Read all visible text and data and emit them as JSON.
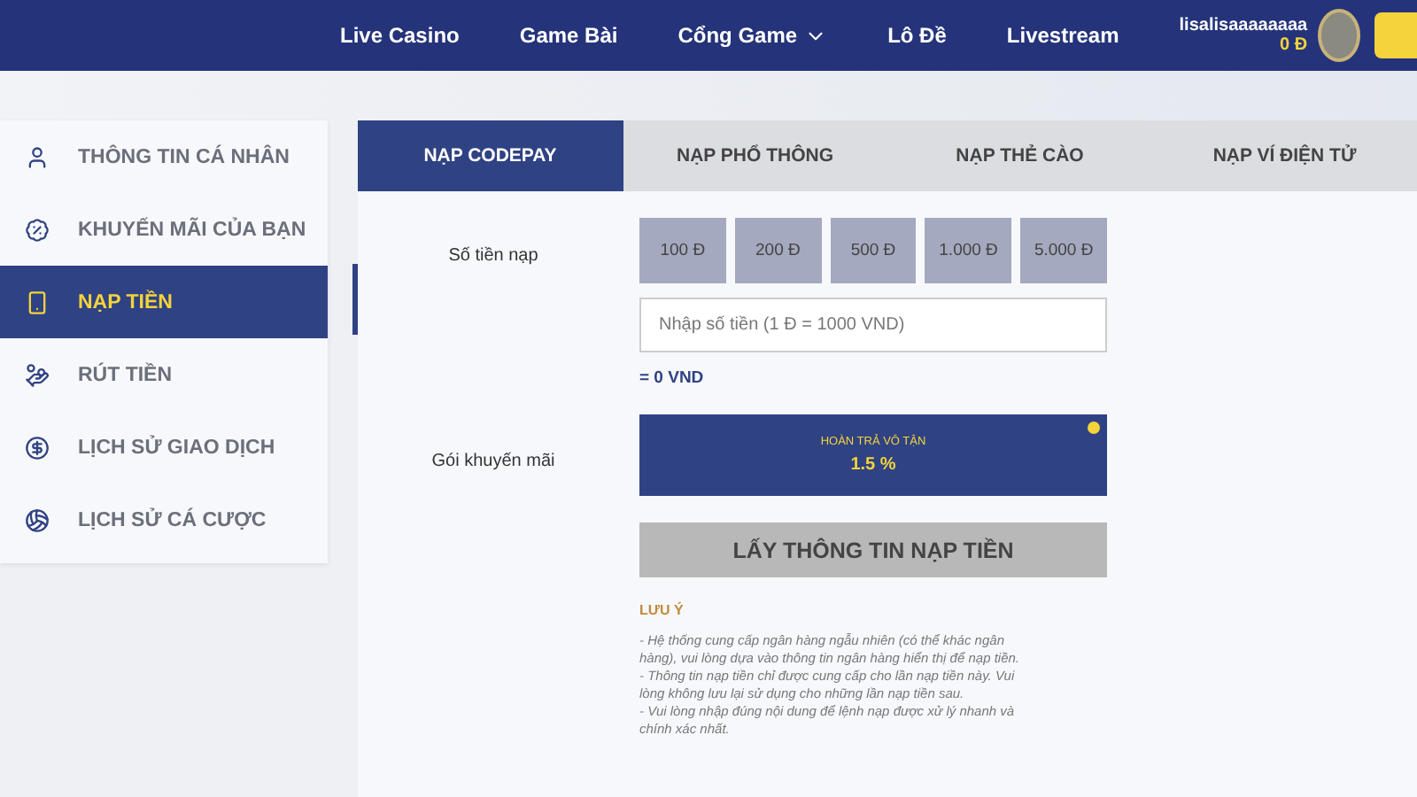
{
  "header": {
    "nav": [
      {
        "label": "Live Casino",
        "kind": "link"
      },
      {
        "label": "Game Bài",
        "kind": "link"
      },
      {
        "label": "Cổng Game",
        "kind": "dropdown"
      },
      {
        "label": "Lô Đề",
        "kind": "link"
      },
      {
        "label": "Livestream",
        "kind": "link"
      }
    ],
    "user": {
      "name": "lisalisaaaaaaaa",
      "balance": "0 Đ"
    }
  },
  "sidebar": {
    "items": [
      {
        "label": "THÔNG TIN CÁ NHÂN",
        "selected": false
      },
      {
        "label": "KHUYẾN MÃI CỦA BẠN",
        "selected": false
      },
      {
        "label": "NẠP TIỀN",
        "selected": true
      },
      {
        "label": "RÚT TIỀN",
        "selected": false
      },
      {
        "label": "LỊCH SỬ GIAO DỊCH",
        "selected": false
      },
      {
        "label": "LỊCH SỬ CÁ CƯỢC",
        "selected": false
      }
    ]
  },
  "tabs": [
    {
      "label": "NẠP CODEPAY",
      "selected": true
    },
    {
      "label": "NẠP PHỔ THÔNG",
      "selected": false
    },
    {
      "label": "NẠP THẺ CÀO",
      "selected": false
    },
    {
      "label": "NẠP VÍ ĐIỆN TỬ",
      "selected": false
    }
  ],
  "form": {
    "amount_label": "Số tiền nạp",
    "amounts": [
      "100 Đ",
      "200 Đ",
      "500 Đ",
      "1.000 Đ",
      "5.000 Đ"
    ],
    "amount_placeholder": "Nhập số tiền (1 Đ = 1000 VND)",
    "converted": "= 0 VND",
    "promo_label": "Gói khuyến mãi",
    "promo": {
      "title": "HOÀN TRẢ VÔ TẬN",
      "value": "1.5 %",
      "selected": true
    },
    "submit": "LẤY THÔNG TIN NẠP TIỀN"
  },
  "notes": {
    "title": "LƯU Ý",
    "lines": [
      "- Hệ thống cung cấp ngân hàng ngẫu nhiên (có thể khác ngân hàng), vui lòng dựa vào thông tin ngân hàng hiển thị để nạp tiền.",
      "- Thông tin nạp tiền chỉ được cung cấp cho lần nạp tiền này. Vui lòng không lưu lại sử dụng cho những lần nạp tiền sau.",
      "- Vui lòng nhập đúng nội dung để lệnh nạp được xử lý nhanh và chính xác nhất."
    ]
  }
}
